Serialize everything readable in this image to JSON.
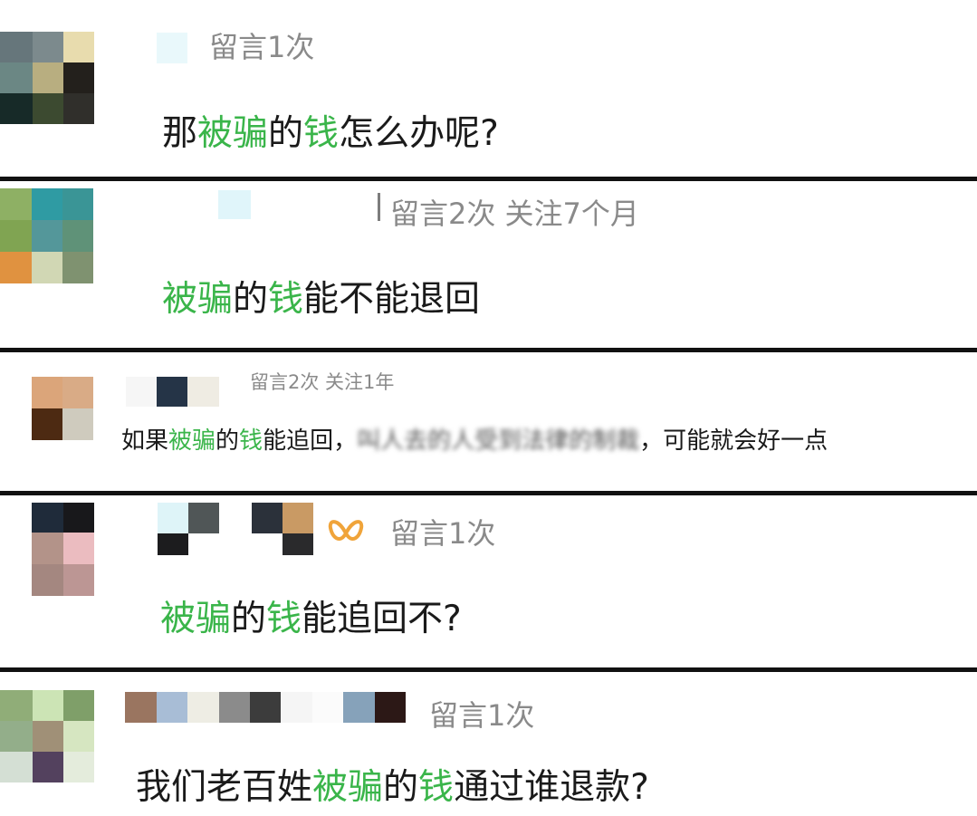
{
  "comments": [
    {
      "meta": "留言1次",
      "content": [
        {
          "t": "那",
          "hl": false
        },
        {
          "t": "被骗",
          "hl": true
        },
        {
          "t": "的",
          "hl": false
        },
        {
          "t": "钱",
          "hl": true
        },
        {
          "t": "怎么办呢?",
          "hl": false
        }
      ]
    },
    {
      "meta": "留言2次 关注7个月",
      "content": [
        {
          "t": "被骗",
          "hl": true
        },
        {
          "t": "的",
          "hl": false
        },
        {
          "t": "钱",
          "hl": true
        },
        {
          "t": "能不能退回",
          "hl": false
        }
      ]
    },
    {
      "meta": "留言2次 关注1年",
      "content": [
        {
          "t": "如果",
          "hl": false
        },
        {
          "t": "被骗",
          "hl": true
        },
        {
          "t": "的",
          "hl": false
        },
        {
          "t": "钱",
          "hl": true
        },
        {
          "t": "能追回，",
          "hl": false
        },
        {
          "t": "叫人去的人受到法律的制裁",
          "blur": true
        },
        {
          "t": "，可能就会好一点",
          "hl": false
        }
      ]
    },
    {
      "meta": "留言1次",
      "content": [
        {
          "t": "被骗",
          "hl": true
        },
        {
          "t": "的",
          "hl": false
        },
        {
          "t": "钱",
          "hl": true
        },
        {
          "t": "能追回不?",
          "hl": false
        }
      ]
    },
    {
      "meta": "留言1次",
      "content": [
        {
          "t": "我们老百姓",
          "hl": false
        },
        {
          "t": "被骗",
          "hl": true
        },
        {
          "t": "的",
          "hl": false
        },
        {
          "t": "钱",
          "hl": true
        },
        {
          "t": "通过谁退款?",
          "hl": false
        }
      ]
    }
  ],
  "colors": {
    "highlight": "#3ab54a",
    "meta_text": "#8a8a8a",
    "separator": "#111111",
    "badge": "#f0a43a"
  },
  "icons": {
    "badge": "butterfly-badge-icon"
  }
}
